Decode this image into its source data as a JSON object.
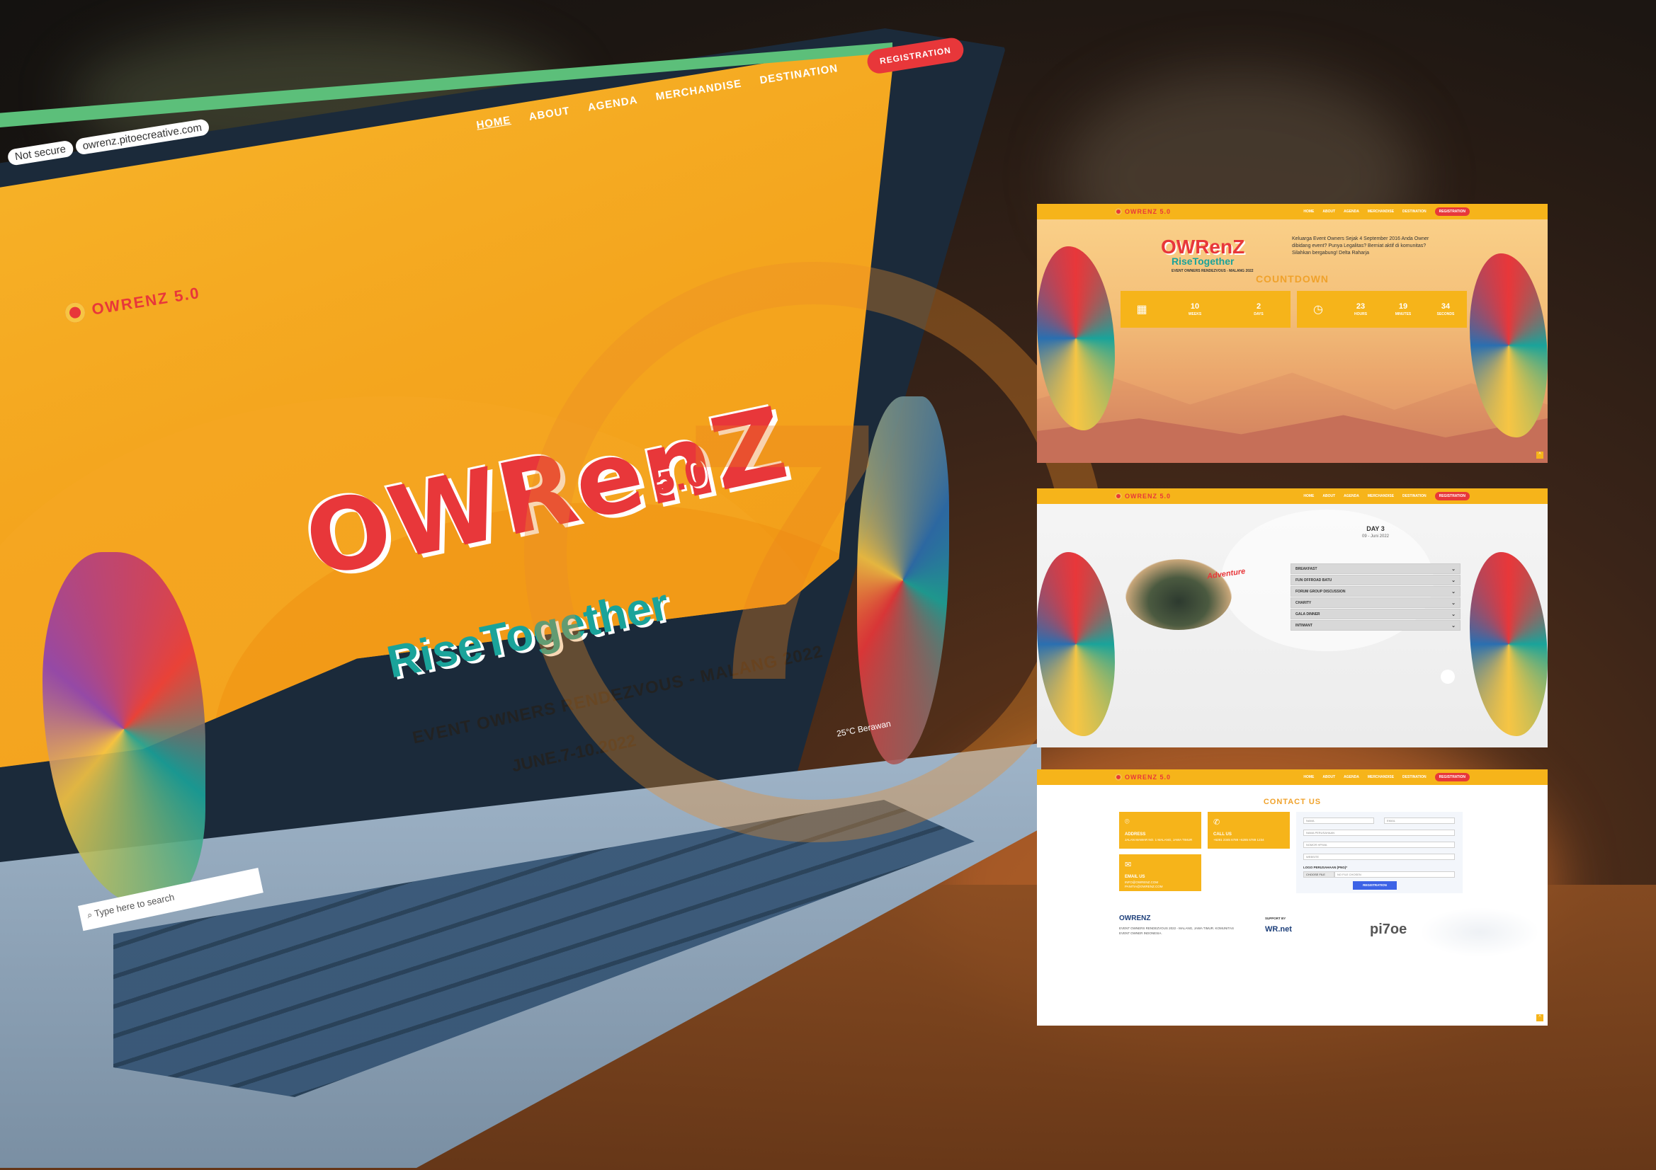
{
  "browser": {
    "url": "owrenz.pitoecreative.com",
    "security_label": "Not secure"
  },
  "site": {
    "logo_text": "OWRENZ 5.0",
    "nav": {
      "home": "HOME",
      "about": "ABOUT",
      "agenda": "AGENDA",
      "merchandise": "MERCHANDISE",
      "destination": "DESTINATION",
      "registration": "REGISTRATION"
    }
  },
  "hero": {
    "title": "OWRenZ",
    "version": "5.0",
    "subtitle": "RiseTogether",
    "tagline": "EVENT OWNERS RENDEZVOUS - MALANG 2022",
    "date": "JUNE.7-10.2022"
  },
  "taskbar": {
    "search_placeholder": "Type here to search",
    "weather": "25°C  Berawan"
  },
  "panel1": {
    "logo_title": "OWRenZ",
    "logo_subtitle": "RiseTogether",
    "logo_caption": "EVENT OWNERS RENDEZVOUS - MALANG 2022",
    "intro": "Keluarga Event Owners Sejak 4 September 2016 Anda Owner dibidang event? Punya Legalitas? Berniat aktif di komunitas? Silahkan bergabung! Delta Raharja",
    "countdown_title": "COUNTDOWN",
    "countdown": [
      {
        "value": "10",
        "label": "WEEKS"
      },
      {
        "value": "2",
        "label": "DAYS"
      },
      {
        "value": "23",
        "label": "HOURS"
      },
      {
        "value": "19",
        "label": "MINUTES"
      },
      {
        "value": "34",
        "label": "SECONDS"
      }
    ]
  },
  "panel2": {
    "day": "DAY 3",
    "date": "09 - Juni 2022",
    "image_label": "Adventure",
    "agenda": [
      "BREAKFAST",
      "FUN OFFROAD BATU",
      "FORUM GROUP DISCUSSION",
      "CHARITY",
      "GALA DINNER",
      "INTIMANT"
    ]
  },
  "panel3": {
    "title": "CONTACT US",
    "address": {
      "heading": "ADDRESS",
      "text": "JALAN MAWAR NO. 1 MALANG, JAWA TIMUR"
    },
    "call": {
      "heading": "CALL US",
      "text": "+6281 2345 6789 +6285 6789 1234"
    },
    "email": {
      "heading": "EMAIL US",
      "text": "INFO@OWRENZ.COM PANITIA@OWRENZ.COM"
    },
    "form": {
      "name": "NAMA",
      "email": "EMAIL",
      "company": "NAMA PERUSAHAAN",
      "phone": "NOMOR HP/WA",
      "website": "WEBSITE",
      "logo_label": "LOGO PERUSAHAAN (PNG)*",
      "choose_file": "CHOOSE FILE",
      "no_file": "NO FILE CHOSEN",
      "submit": "REGISTRATION"
    },
    "footer": {
      "logo": "OWRENZ",
      "text": "EVENT OWNERS RENDEZVOUS 2022 - MALANG, JAWA TIMUR. KOMUNITAS EVENT OWNER INDONESIA.",
      "support_label": "SUPPORT BY",
      "sponsor1": "WR.net",
      "sponsor2": "pi7oe"
    }
  }
}
